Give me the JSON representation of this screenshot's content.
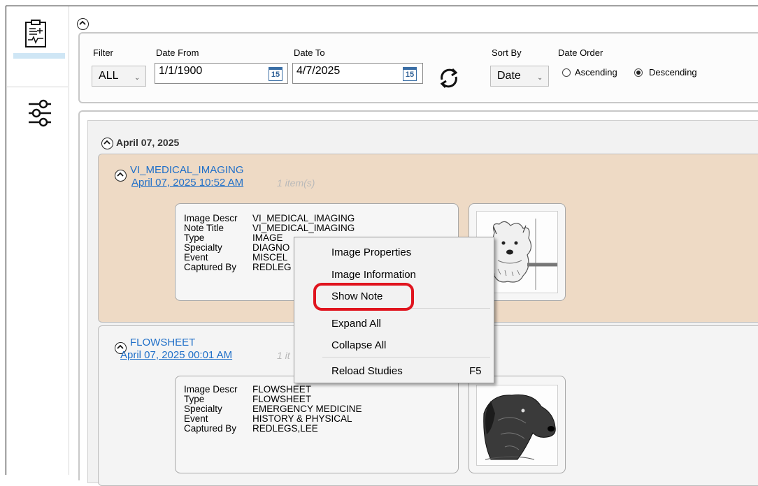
{
  "filter": {
    "filter_label": "Filter",
    "filter_value": "ALL",
    "date_from_label": "Date From",
    "date_from_value": "1/1/1900",
    "date_to_label": "Date To",
    "date_to_value": "4/7/2025",
    "calendar_glyph": "15",
    "sort_by_label": "Sort By",
    "sort_by_value": "Date",
    "date_order_label": "Date Order",
    "ascending_label": "Ascending",
    "descending_label": "Descending",
    "selected_order": "Descending"
  },
  "date_group": {
    "label": "April 07, 2025"
  },
  "studies": [
    {
      "title": "VI_MEDICAL_IMAGING",
      "datetime": "April 07, 2025 10:52 AM",
      "count": "1 item(s)",
      "fields": [
        {
          "key": "Image Descr",
          "value": "VI_MEDICAL_IMAGING"
        },
        {
          "key": "Note Title",
          "value": "VI_MEDICAL_IMAGING"
        },
        {
          "key": "Type",
          "value": "IMAGE"
        },
        {
          "key": "Specialty",
          "value": "DIAGNO"
        },
        {
          "key": "Event",
          "value": "MISCEL"
        },
        {
          "key": "Captured By",
          "value": "REDLEG"
        }
      ]
    },
    {
      "title": "FLOWSHEET",
      "datetime": "April 07, 2025 00:01 AM",
      "count": "1 it",
      "fields": [
        {
          "key": "Image Descr",
          "value": "FLOWSHEET"
        },
        {
          "key": "Type",
          "value": "FLOWSHEET"
        },
        {
          "key": "Specialty",
          "value": "EMERGENCY MEDICINE"
        },
        {
          "key": "Event",
          "value": "HISTORY & PHYSICAL"
        },
        {
          "key": "Captured By",
          "value": "REDLEGS,LEE"
        }
      ]
    }
  ],
  "context_menu": {
    "items": [
      {
        "label": "Image Properties",
        "shortcut": ""
      },
      {
        "label": "Image Information",
        "shortcut": ""
      },
      {
        "label": "Show Note",
        "shortcut": ""
      },
      {
        "label": "Expand All",
        "shortcut": ""
      },
      {
        "label": "Collapse All",
        "shortcut": ""
      },
      {
        "label": "Reload Studies",
        "shortcut": "F5"
      }
    ]
  },
  "colors": {
    "group_highlight": "#eedac5",
    "link": "#1f6fc8",
    "annotation_ring": "#e0141e"
  }
}
